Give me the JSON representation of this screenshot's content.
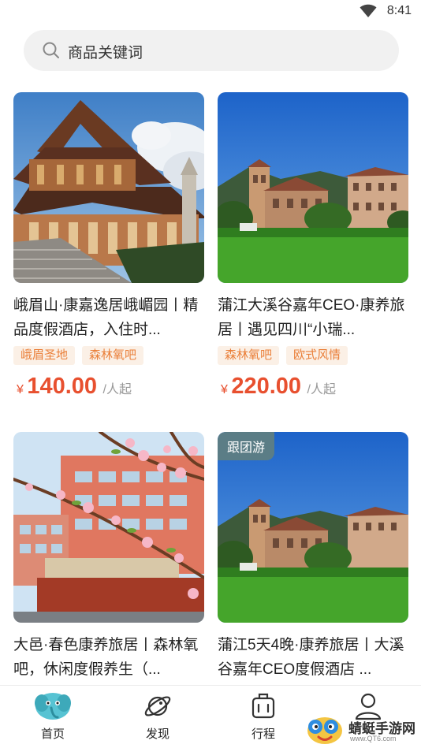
{
  "status_bar": {
    "time": "8:41"
  },
  "search": {
    "placeholder": "商品关键词"
  },
  "products": [
    {
      "title": "峨眉山·康嘉逸居峨嵋园丨精品度假酒店，入住时...",
      "tags": [
        "峨眉圣地",
        "森林氧吧"
      ],
      "currency": "¥",
      "price": "140.00",
      "unit": "/人起",
      "image": "temple"
    },
    {
      "title": "蒲江大溪谷嘉年CEO·康养旅居丨遇见四川“小瑞...",
      "tags": [
        "森林氧吧",
        "欧式风情"
      ],
      "currency": "¥",
      "price": "220.00",
      "unit": "/人起",
      "image": "villa"
    },
    {
      "title": "大邑·春色康养旅居丨森林氧吧，休闲度假养生（...",
      "image": "blossom"
    },
    {
      "title": "蒲江5天4晚·康养旅居丨大溪谷嘉年CEO度假酒店 ...",
      "badge": "跟团游",
      "image": "villa"
    }
  ],
  "tabbar": [
    {
      "label": "首页",
      "icon": "home-elephant-icon",
      "active": true
    },
    {
      "label": "发现",
      "icon": "planet-icon"
    },
    {
      "label": "行程",
      "icon": "luggage-icon"
    },
    {
      "label": "我的",
      "icon": "person-icon"
    }
  ],
  "watermark": {
    "text": "蜻蜓手游网",
    "url": "www.QT6.com"
  }
}
